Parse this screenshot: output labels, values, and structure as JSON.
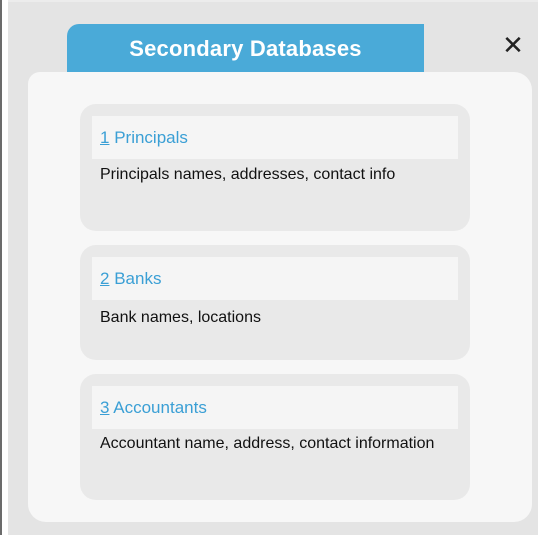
{
  "window": {
    "title_tab": "Secondary Databases",
    "close_symbol": "✕"
  },
  "cards": [
    {
      "number": "1",
      "title": "Principals",
      "description": "Principals names, addresses, contact info"
    },
    {
      "number": "2",
      "title": "Banks",
      "description": "Bank names, locations"
    },
    {
      "number": "3",
      "title": "Accountants",
      "description": "Accountant name, address, contact information"
    }
  ],
  "colors": {
    "tab": "#4aaad8",
    "link": "#3a9fd5",
    "dialog_bg": "#e4e4e4",
    "panel_bg": "#f7f7f7",
    "card_bg": "#e9e9e9"
  }
}
